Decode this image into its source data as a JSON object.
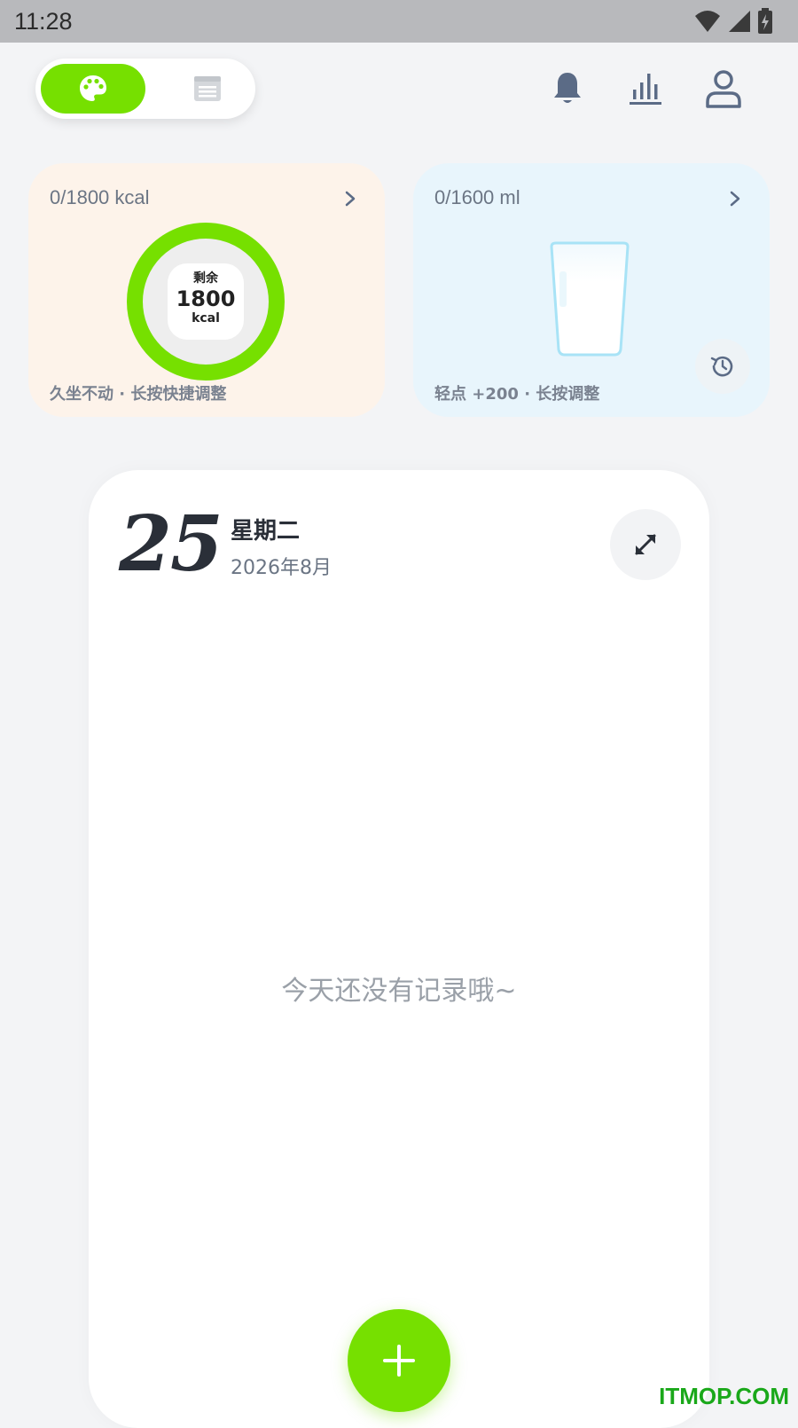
{
  "status_bar": {
    "time": "11:28"
  },
  "mode_toggle": {
    "active_icon": "palette-icon",
    "inactive_icon": "list-view-icon"
  },
  "top_actions": [
    "bell-icon",
    "stats-icon",
    "profile-icon"
  ],
  "calorie_card": {
    "header": "0/1800 kcal",
    "ring_label": "剩余",
    "ring_value": "1800",
    "ring_unit": "kcal",
    "footer": "久坐不动 · 长按快捷调整",
    "progress": 0,
    "ring_color": "#76e000"
  },
  "water_card": {
    "header": "0/1600 ml",
    "footer": "轻点 +200 · 长按调整",
    "progress": 0
  },
  "day_card": {
    "day": "25",
    "weekday": "星期二",
    "year_month": "2026年8月",
    "empty_message": "今天还没有记录哦~"
  },
  "colors": {
    "accent": "#76e000",
    "calorie_bg": "#fdf3ea",
    "water_bg": "#e8f5fc"
  },
  "watermark": "ITMOP.COM"
}
